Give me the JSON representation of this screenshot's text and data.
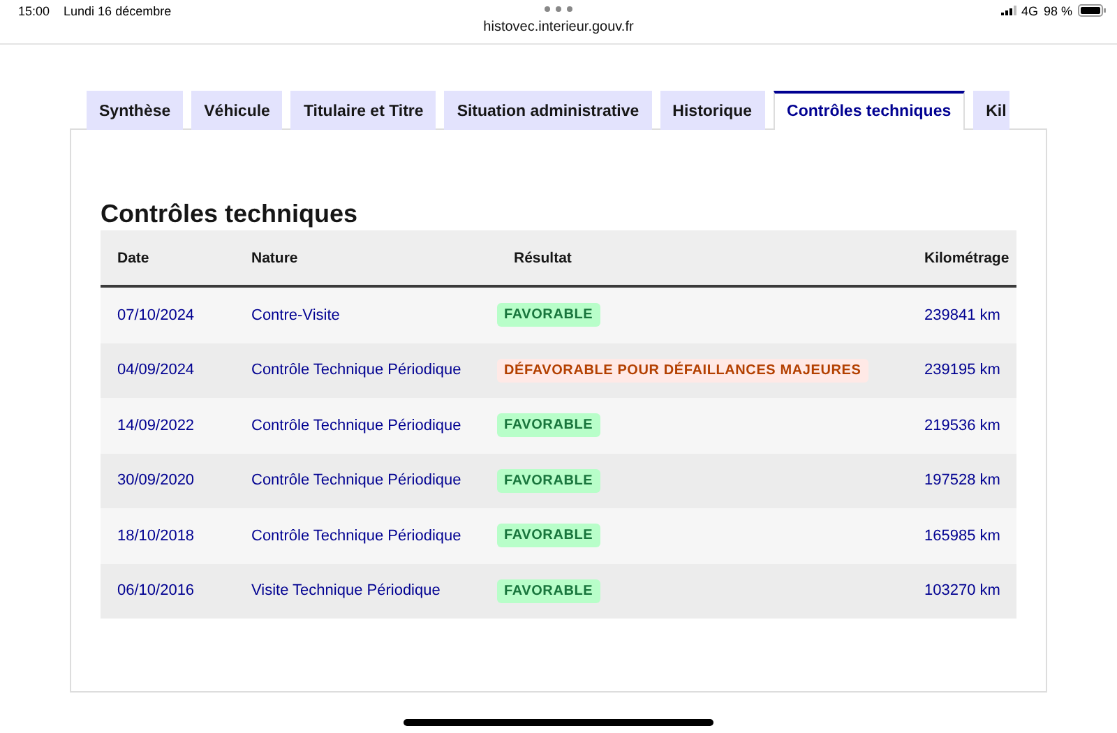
{
  "status_bar": {
    "time": "15:00",
    "date": "Lundi 16 décembre",
    "network": "4G",
    "battery": "98 %"
  },
  "address_bar": {
    "url": "histovec.interieur.gouv.fr"
  },
  "tabs": [
    {
      "label": "Synthèse",
      "selected": false
    },
    {
      "label": "Véhicule",
      "selected": false
    },
    {
      "label": "Titulaire et Titre",
      "selected": false
    },
    {
      "label": "Situation administrative",
      "selected": false
    },
    {
      "label": "Historique",
      "selected": false
    },
    {
      "label": "Contrôles techniques",
      "selected": true
    },
    {
      "label": "Kil",
      "selected": false
    }
  ],
  "section": {
    "title": "Contrôles techniques"
  },
  "table": {
    "columns": [
      "Date",
      "Nature",
      "Résultat",
      "Kilométrage"
    ],
    "rows": [
      {
        "date": "07/10/2024",
        "nature": "Contre-Visite",
        "result": {
          "label": "FAVORABLE",
          "kind": "favorable"
        },
        "mileage": "239841 km"
      },
      {
        "date": "04/09/2024",
        "nature": "Contrôle Technique Périodique",
        "result": {
          "label": "DÉFAVORABLE POUR DÉFAILLANCES MAJEURES",
          "kind": "unfavorable"
        },
        "mileage": "239195 km"
      },
      {
        "date": "14/09/2022",
        "nature": "Contrôle Technique Périodique",
        "result": {
          "label": "FAVORABLE",
          "kind": "favorable"
        },
        "mileage": "219536 km"
      },
      {
        "date": "30/09/2020",
        "nature": "Contrôle Technique Périodique",
        "result": {
          "label": "FAVORABLE",
          "kind": "favorable"
        },
        "mileage": "197528 km"
      },
      {
        "date": "18/10/2018",
        "nature": "Contrôle Technique Périodique",
        "result": {
          "label": "FAVORABLE",
          "kind": "favorable"
        },
        "mileage": "165985 km"
      },
      {
        "date": "06/10/2016",
        "nature": "Visite Technique Périodique",
        "result": {
          "label": "FAVORABLE",
          "kind": "favorable"
        },
        "mileage": "103270 km"
      }
    ]
  }
}
